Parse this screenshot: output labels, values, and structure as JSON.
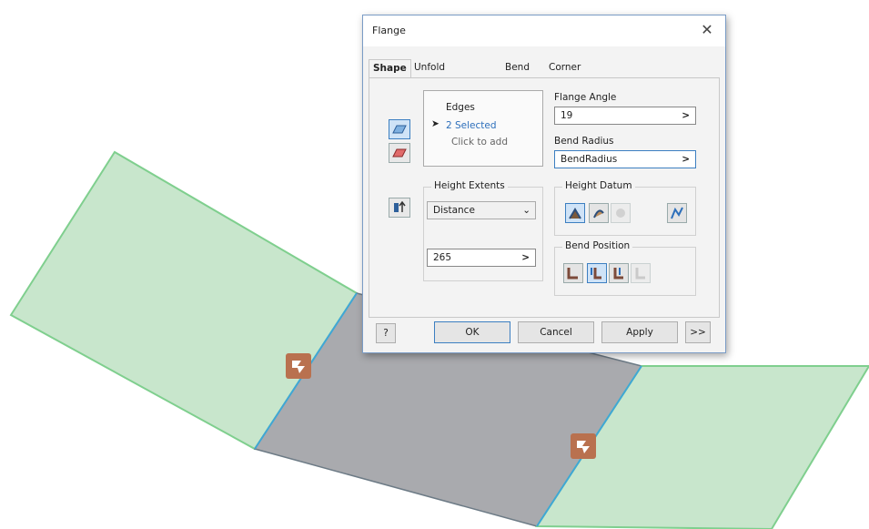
{
  "dialog": {
    "title": "Flange",
    "close_glyph": "✕",
    "tabs": [
      {
        "label": "Shape",
        "active": true
      },
      {
        "label": "Unfold Options",
        "active": false
      },
      {
        "label": "Bend",
        "active": false
      },
      {
        "label": "Corner",
        "active": false
      }
    ],
    "edges": {
      "heading": "Edges",
      "selected": "2 Selected",
      "hint": "Click to add"
    },
    "flange_angle": {
      "label": "Flange Angle",
      "value": "19",
      "arrow": ">"
    },
    "bend_radius": {
      "label": "Bend Radius",
      "value": "BendRadius",
      "arrow": ">"
    },
    "height_extents": {
      "label": "Height Extents",
      "option": "Distance",
      "value": "265",
      "arrow": ">"
    },
    "height_datum": {
      "label": "Height Datum"
    },
    "bend_position": {
      "label": "Bend Position"
    },
    "buttons": {
      "help": "?",
      "ok": "OK",
      "cancel": "Cancel",
      "apply": "Apply",
      "more": ">>"
    }
  },
  "colors": {
    "flange_face": "#c8e6cc",
    "flange_edge": "#7fcf8e",
    "base_face": "#a9aaae",
    "bend_marker": "#b9714f",
    "accent": "#3c7fc1"
  },
  "icons": [
    "edge-select-icon",
    "loop-select-icon",
    "flip-direction-icon",
    "bend-marker-icon"
  ]
}
